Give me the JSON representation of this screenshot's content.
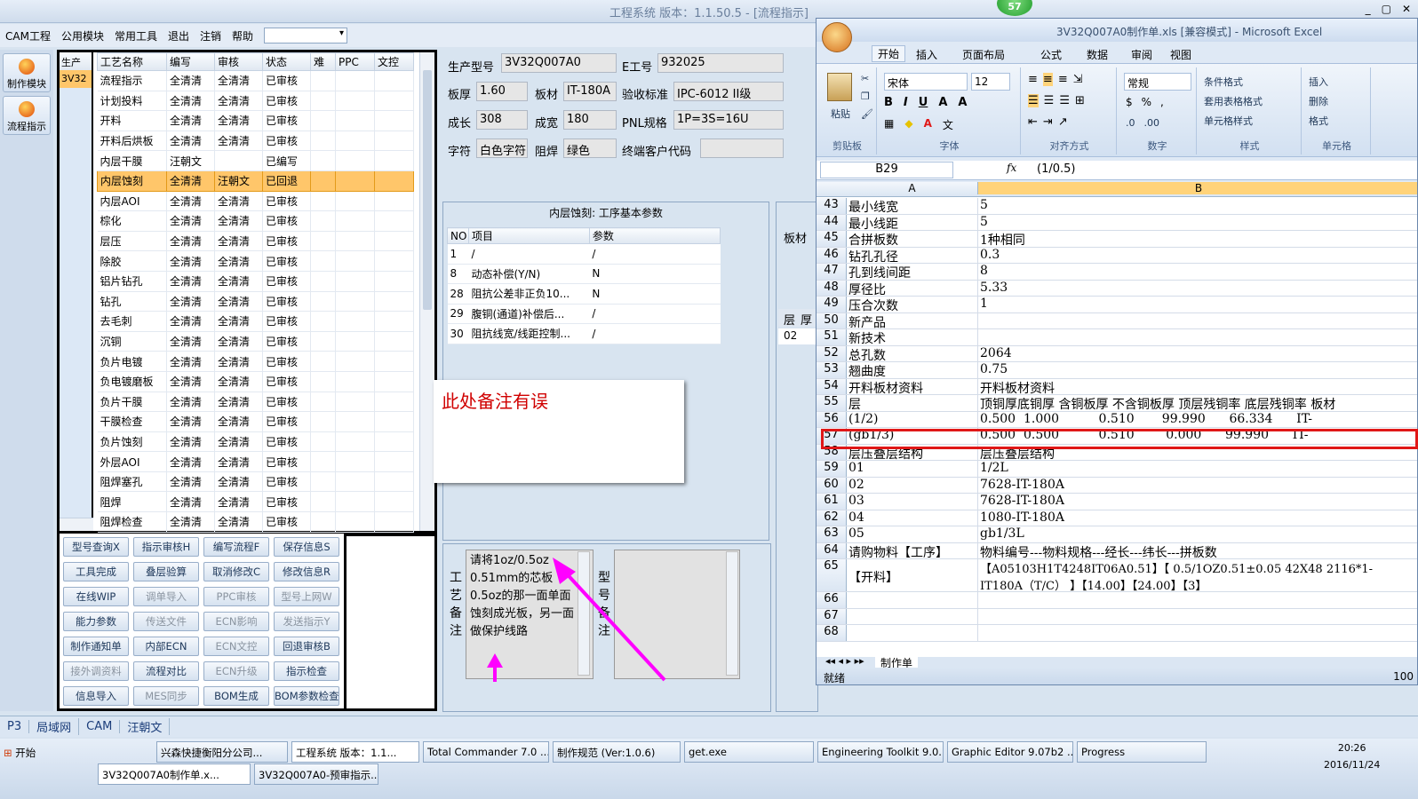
{
  "app": {
    "title": "工程系统  版本：1.1.50.5 - [流程指示]",
    "window_controls": [
      "_",
      "▢",
      "✕"
    ]
  },
  "menu": [
    "CAM工程",
    "公用模块",
    "常用工具",
    "退出",
    "注销",
    "帮助"
  ],
  "sidebar": [
    {
      "label": "制作模块",
      "icon": "fire-icon"
    },
    {
      "label": "流程指示",
      "icon": "flow-icon"
    }
  ],
  "prod_col": {
    "header": "生产",
    "value": "3V32"
  },
  "process_table": {
    "headers": [
      "工艺名称",
      "编写",
      "审核",
      "状态",
      "难",
      "PPC",
      "文控"
    ],
    "rows": [
      [
        "流程指示",
        "全清清",
        "全清清",
        "已审核"
      ],
      [
        "计划投料",
        "全清清",
        "全清清",
        "已审核"
      ],
      [
        "开料",
        "全清清",
        "全清清",
        "已审核"
      ],
      [
        "开料后烘板",
        "全清清",
        "全清清",
        "已审核"
      ],
      [
        "内层干膜",
        "汪朝文",
        "",
        "已编写"
      ],
      [
        "内层蚀刻",
        "全清清",
        "汪朝文",
        "已回退"
      ],
      [
        "内层AOI",
        "全清清",
        "全清清",
        "已审核"
      ],
      [
        "棕化",
        "全清清",
        "全清清",
        "已审核"
      ],
      [
        "层压",
        "全清清",
        "全清清",
        "已审核"
      ],
      [
        "除胶",
        "全清清",
        "全清清",
        "已审核"
      ],
      [
        "铝片钻孔",
        "全清清",
        "全清清",
        "已审核"
      ],
      [
        "钻孔",
        "全清清",
        "全清清",
        "已审核"
      ],
      [
        "去毛刺",
        "全清清",
        "全清清",
        "已审核"
      ],
      [
        "沉铜",
        "全清清",
        "全清清",
        "已审核"
      ],
      [
        "负片电镀",
        "全清清",
        "全清清",
        "已审核"
      ],
      [
        "负电镀磨板",
        "全清清",
        "全清清",
        "已审核"
      ],
      [
        "负片干膜",
        "全清清",
        "全清清",
        "已审核"
      ],
      [
        "干膜检查",
        "全清清",
        "全清清",
        "已审核"
      ],
      [
        "负片蚀刻",
        "全清清",
        "全清清",
        "已审核"
      ],
      [
        "外层AOI",
        "全清清",
        "全清清",
        "已审核"
      ],
      [
        "阻焊塞孔",
        "全清清",
        "全清清",
        "已审核"
      ],
      [
        "阻焊",
        "全清清",
        "全清清",
        "已审核"
      ],
      [
        "阻焊检查",
        "全清清",
        "全清清",
        "已审核"
      ]
    ],
    "selected_index": 5
  },
  "buttons": [
    {
      "label": "型号查询X",
      "enabled": true
    },
    {
      "label": "指示审核H",
      "enabled": true
    },
    {
      "label": "编写流程F",
      "enabled": true
    },
    {
      "label": "保存信息S",
      "enabled": true
    },
    {
      "label": "工具完成",
      "enabled": true
    },
    {
      "label": "叠层验算",
      "enabled": true
    },
    {
      "label": "取消修改C",
      "enabled": true
    },
    {
      "label": "修改信息R",
      "enabled": true
    },
    {
      "label": "在线WIP",
      "enabled": true
    },
    {
      "label": "调单导入",
      "enabled": false
    },
    {
      "label": "PPC审核",
      "enabled": false
    },
    {
      "label": "型号上网W",
      "enabled": false
    },
    {
      "label": "能力参数",
      "enabled": true
    },
    {
      "label": "传送文件",
      "enabled": false
    },
    {
      "label": "ECN影响",
      "enabled": false
    },
    {
      "label": "发送指示Y",
      "enabled": false
    },
    {
      "label": "制作通知单",
      "enabled": true
    },
    {
      "label": "内部ECN",
      "enabled": true
    },
    {
      "label": "ECN文控",
      "enabled": false
    },
    {
      "label": "回退审核B",
      "enabled": true
    },
    {
      "label": "接外调资料",
      "enabled": false
    },
    {
      "label": "流程对比",
      "enabled": true
    },
    {
      "label": "ECN升级",
      "enabled": false
    },
    {
      "label": "指示检查",
      "enabled": true
    },
    {
      "label": "信息导入",
      "enabled": true
    },
    {
      "label": "MES同步",
      "enabled": false
    },
    {
      "label": "BOM生成",
      "enabled": true
    },
    {
      "label": "BOM参数检查",
      "enabled": true
    }
  ],
  "info": {
    "model_label": "生产型号",
    "model": "3V32Q007A0",
    "eno_label": "E工号",
    "eno": "932025",
    "thick_label": "板厚",
    "thick": "1.60",
    "mat_label": "板材",
    "mat": "IT-180A",
    "std_label": "验收标准",
    "std": "IPC-6012 II级",
    "len_label": "成长",
    "len": "308",
    "wid_label": "成宽",
    "wid": "180",
    "pnl_label": "PNL规格",
    "pnl": "1P=3S=16U",
    "char_label": "字符",
    "char": "白色字符",
    "mask_label": "阻焊",
    "mask": "绿色",
    "cust_label": "终端客户代码",
    "cust": ""
  },
  "params": {
    "title": "内层蚀刻: 工序基本参数",
    "headers": [
      "NO",
      "项目",
      "参数"
    ],
    "rows": [
      [
        "1",
        "/",
        "/"
      ],
      [
        "8",
        "动态补偿(Y/N)",
        "N"
      ],
      [
        "28",
        "阻抗公差非正负10...",
        "N"
      ],
      [
        "29",
        "腹铜(通道)补偿后...",
        "/"
      ],
      [
        "30",
        "阻抗线宽/线距控制...",
        "/"
      ]
    ]
  },
  "note_popup": "此处备注有误",
  "remarks": {
    "label1": "工艺备注",
    "text": "请将1oz/0.5oz 0.51mm的芯板 0.5oz的那一面单面 蚀刻成光板，另一面做保护线路",
    "label2": "型号备注"
  },
  "midpanel": {
    "label": "板材",
    "h1": "层",
    "h2": "厚",
    "row": "02"
  },
  "excel": {
    "title": "3V32Q007A0制作单.xls [兼容模式] - Microsoft Excel",
    "tabs": [
      "开始",
      "插入",
      "页面布局",
      "公式",
      "数据",
      "审阅",
      "视图"
    ],
    "font": "宋体",
    "size": "12",
    "numfmt": "常规",
    "groups": [
      "剪贴板",
      "字体",
      "对齐方式",
      "数字",
      "样式",
      "单元格"
    ],
    "paste": "粘贴",
    "styles": [
      "条件格式",
      "套用表格格式",
      "单元格样式"
    ],
    "cells": [
      "插入",
      "删除",
      "格式"
    ],
    "cellref": "B29",
    "formula": "(1/0.5)",
    "cols": [
      "A",
      "B"
    ],
    "rows": [
      [
        "43",
        "最小线宽",
        "5"
      ],
      [
        "44",
        "最小线距",
        "5"
      ],
      [
        "45",
        "合拼板数",
        "1种相同"
      ],
      [
        "46",
        "钻孔孔径",
        "0.3"
      ],
      [
        "47",
        "孔到线间距",
        "8"
      ],
      [
        "48",
        "厚径比",
        "5.33"
      ],
      [
        "49",
        "压合次数",
        "1"
      ],
      [
        "50",
        "新产品",
        ""
      ],
      [
        "51",
        "新技术",
        ""
      ],
      [
        "52",
        "总孔数",
        "2064"
      ],
      [
        "53",
        "翘曲度",
        "0.75"
      ],
      [
        "54",
        "开料板材资料",
        "开料板材资料"
      ],
      [
        "55",
        "层",
        "顶铜厚底铜厚 含铜板厚 不含铜板厚 顶层残铜率 底层残铜率 板材"
      ],
      [
        "56",
        "(1/2)",
        "0.500  1.000          0.510       99.990      66.334      IT-"
      ],
      [
        "57",
        "(gb1/3)",
        "0.500  0.500          0.510        0.000      99.990      IT-"
      ],
      [
        "58",
        "层压叠层结构",
        "层压叠层结构"
      ],
      [
        "59",
        "01",
        "1/2L"
      ],
      [
        "60",
        "02",
        "7628-IT-180A"
      ],
      [
        "61",
        "03",
        "7628-IT-180A"
      ],
      [
        "62",
        "04",
        "1080-IT-180A"
      ],
      [
        "63",
        "05",
        "gb1/3L"
      ],
      [
        "64",
        "请购物料【工序】",
        "物料编号---物料规格---经长---纬长---拼板数"
      ],
      [
        "65",
        "【开料】",
        "【A05103H1T4248IT06A0.51】【 0.5/1OZ0.51±0.05 42X48 2116*1-\nIT180A（T/C） 】【14.00】【24.00】【3】"
      ],
      [
        "66",
        "",
        ""
      ],
      [
        "67",
        "",
        ""
      ],
      [
        "68",
        "",
        ""
      ]
    ],
    "sheet_tab": "制作单",
    "status": "就绪",
    "zoom": "100"
  },
  "bottom_tabs": [
    "P3",
    "局域网",
    "CAM",
    "汪朝文"
  ],
  "taskbar": {
    "start": "开始",
    "row1": [
      "兴森快捷衡阳分公司...",
      "工程系统  版本：1.1...",
      "Total Commander 7.0 ...",
      "制作规范 (Ver:1.0.6)",
      "get.exe",
      "Engineering Toolkit 9.0...",
      "Graphic Editor 9.07b2 ...",
      "Progress"
    ],
    "row2": [
      "3V32Q007A0制作单.x...",
      "3V32Q007A0-预审指示...."
    ],
    "time": "20:26",
    "date": "2016/11/24"
  },
  "badge": "57"
}
